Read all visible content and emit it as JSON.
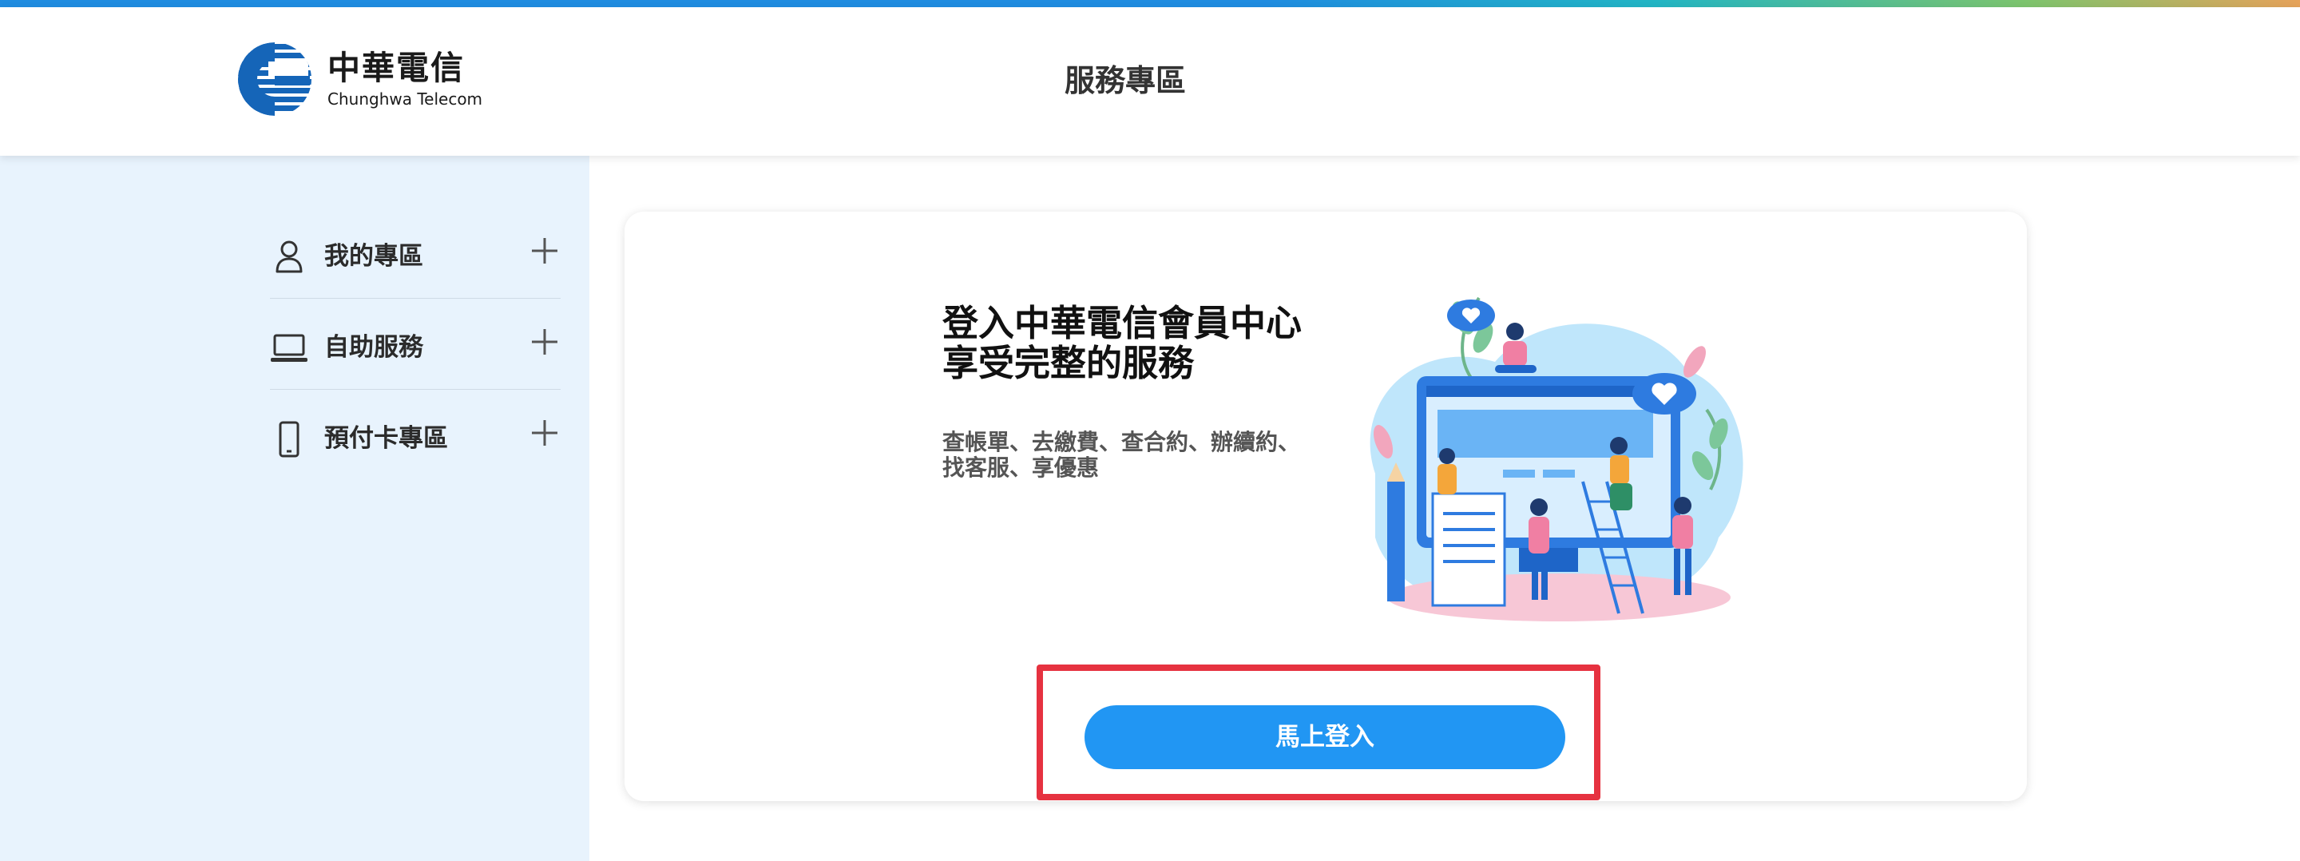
{
  "header": {
    "logo_cn": "中華電信",
    "logo_en": "Chunghwa Telecom",
    "title": "服務專區"
  },
  "sidebar": {
    "items": [
      {
        "label": "我的專區",
        "icon": "user-icon"
      },
      {
        "label": "自助服務",
        "icon": "laptop-icon"
      },
      {
        "label": "預付卡專區",
        "icon": "mobile-phone-icon"
      }
    ]
  },
  "card": {
    "title_line1": "登入中華電信會員中心",
    "title_line2": "享受完整的服務",
    "subtitle_line1": "查帳單、去繳費、查合約、辦續約、",
    "subtitle_line2": "找客服、享優惠",
    "login_button": "馬上登入"
  },
  "colors": {
    "brand_blue": "#1f8ce0",
    "button_blue": "#2196f3",
    "highlight_red": "#e63240",
    "sidebar_bg": "#e8f3fd"
  }
}
